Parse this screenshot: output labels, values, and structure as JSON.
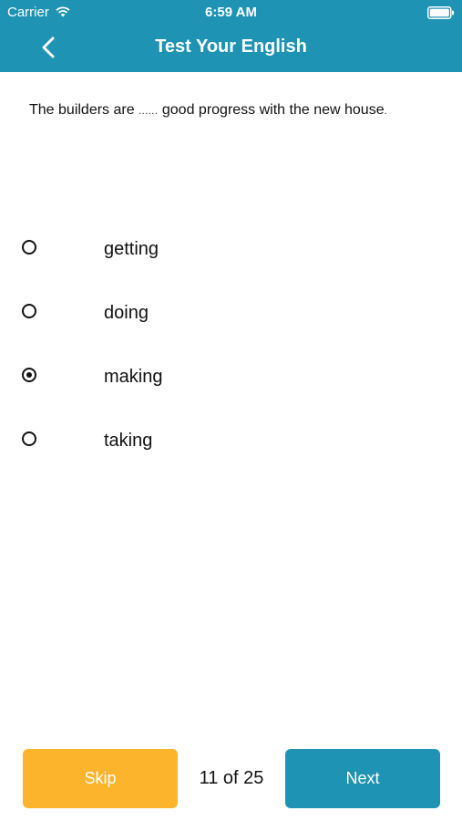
{
  "status_bar": {
    "carrier": "Carrier",
    "time": "6:59 AM",
    "wifi_icon": "wifi-icon",
    "battery_icon": "battery-full-icon"
  },
  "nav": {
    "title": "Test Your English",
    "back_icon": "chevron-left-icon"
  },
  "question": {
    "before": "The builders are",
    "blank": "......",
    "after": "good progress with the new house",
    "end": "."
  },
  "options": [
    {
      "label": "getting",
      "selected": false
    },
    {
      "label": "doing",
      "selected": false
    },
    {
      "label": "making",
      "selected": true
    },
    {
      "label": "taking",
      "selected": false
    }
  ],
  "footer": {
    "skip_label": "Skip",
    "progress": "11 of 25",
    "next_label": "Next"
  },
  "colors": {
    "accent": "#1e93b3",
    "skip": "#fbb42b"
  }
}
